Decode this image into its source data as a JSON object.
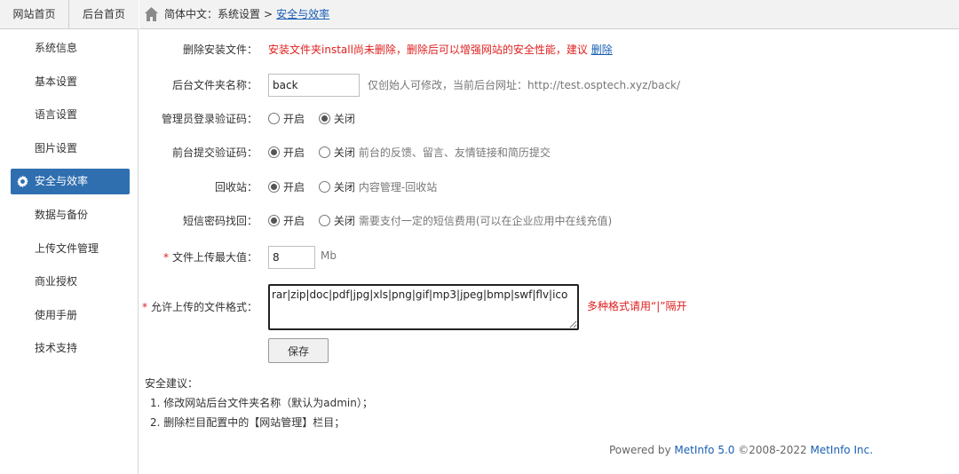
{
  "top_tabs": {
    "site_home": "网站首页",
    "admin_home": "后台首页"
  },
  "breadcrumb": {
    "lang": "简体中文",
    "colon": "：",
    "section": "系统设置",
    "sep": ">",
    "current": "安全与效率"
  },
  "sidebar": {
    "items": [
      {
        "label": "系统信息"
      },
      {
        "label": "基本设置"
      },
      {
        "label": "语言设置"
      },
      {
        "label": "图片设置"
      },
      {
        "label": "安全与效率",
        "active": true,
        "icon": "gear-icon"
      },
      {
        "label": "数据与备份"
      },
      {
        "label": "上传文件管理"
      },
      {
        "label": "商业授权"
      },
      {
        "label": "使用手册"
      },
      {
        "label": "技术支持"
      }
    ]
  },
  "form": {
    "delete_install": {
      "label": "删除安装文件：",
      "warning": "安装文件夹install尚未删除，删除后可以增强网站的安全性能，建议",
      "link": "删除"
    },
    "admin_folder": {
      "label": "后台文件夹名称：",
      "value": "back",
      "hint": "仅创始人可修改，当前后台网址：http://test.osptech.xyz/back/"
    },
    "admin_captcha": {
      "label": "管理员登录验证码：",
      "options": [
        "开启",
        "关闭"
      ],
      "selected": "关闭"
    },
    "front_captcha": {
      "label": "前台提交验证码：",
      "options": [
        "开启",
        "关闭"
      ],
      "selected": "开启",
      "hint": "前台的反馈、留言、友情链接和简历提交"
    },
    "recycle_bin": {
      "label": "回收站：",
      "options": [
        "开启",
        "关闭"
      ],
      "selected": "开启",
      "hint": "内容管理-回收站"
    },
    "sms_password": {
      "label": "短信密码找回：",
      "options": [
        "开启",
        "关闭"
      ],
      "selected": "开启",
      "hint": "需要支付一定的短信费用(可以在企业应用中在线充值)"
    },
    "max_upload": {
      "required": "*",
      "label": "文件上传最大值：",
      "value": "8",
      "unit": "Mb"
    },
    "allowed_formats": {
      "required": "*",
      "label": "允许上传的文件格式：",
      "value": "rar|zip|doc|pdf|jpg|xls|png|gif|mp3|jpeg|bmp|swf|flv|ico",
      "hint": "多种格式请用“|”隔开"
    },
    "save_label": "保存"
  },
  "advice": {
    "title": "安全建议：",
    "items": [
      "1. 修改网站后台文件夹名称（默认为admin）；",
      "2. 删除栏目配置中的【网站管理】栏目；"
    ]
  },
  "footer": {
    "powered": "Powered by ",
    "brand": "MetInfo 5.0",
    "copyright": " ©2008-2022 ",
    "company": "MetInfo Inc."
  },
  "colors": {
    "accent": "#2f6fb0",
    "link": "#1a5fb4",
    "warning": "#e02020"
  }
}
